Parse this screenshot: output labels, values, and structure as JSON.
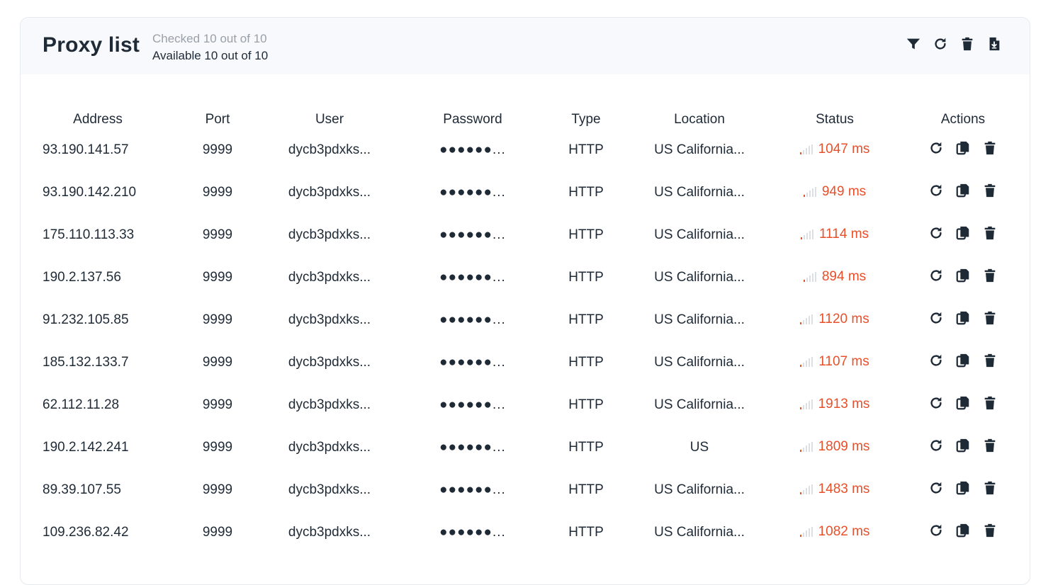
{
  "header": {
    "title": "Proxy list",
    "checked": "Checked 10 out of 10",
    "available": "Available 10 out of 10"
  },
  "toolbar": {
    "icons": [
      "filter-icon",
      "refresh-icon",
      "trash-icon",
      "file-download-icon"
    ]
  },
  "colors": {
    "accent": "#e8502a",
    "text": "#1f2a37",
    "muted": "#9aa0a8",
    "header_bg": "#f7f9fc"
  },
  "table": {
    "columns": [
      "Address",
      "Port",
      "User",
      "Password",
      "Type",
      "Location",
      "Status",
      "Actions"
    ],
    "rows": [
      {
        "address": "93.190.141.57",
        "port": "9999",
        "user": "dycb3pdxks...",
        "password": "●●●●●●...",
        "type": "HTTP",
        "location": "US California...",
        "status": "1047 ms"
      },
      {
        "address": "93.190.142.210",
        "port": "9999",
        "user": "dycb3pdxks...",
        "password": "●●●●●●...",
        "type": "HTTP",
        "location": "US California...",
        "status": "949 ms"
      },
      {
        "address": "175.110.113.33",
        "port": "9999",
        "user": "dycb3pdxks...",
        "password": "●●●●●●...",
        "type": "HTTP",
        "location": "US California...",
        "status": "1114 ms"
      },
      {
        "address": "190.2.137.56",
        "port": "9999",
        "user": "dycb3pdxks...",
        "password": "●●●●●●...",
        "type": "HTTP",
        "location": "US California...",
        "status": "894 ms"
      },
      {
        "address": "91.232.105.85",
        "port": "9999",
        "user": "dycb3pdxks...",
        "password": "●●●●●●...",
        "type": "HTTP",
        "location": "US California...",
        "status": "1120 ms"
      },
      {
        "address": "185.132.133.7",
        "port": "9999",
        "user": "dycb3pdxks...",
        "password": "●●●●●●...",
        "type": "HTTP",
        "location": "US California...",
        "status": "1107 ms"
      },
      {
        "address": "62.112.11.28",
        "port": "9999",
        "user": "dycb3pdxks...",
        "password": "●●●●●●...",
        "type": "HTTP",
        "location": "US California...",
        "status": "1913 ms"
      },
      {
        "address": "190.2.142.241",
        "port": "9999",
        "user": "dycb3pdxks...",
        "password": "●●●●●●...",
        "type": "HTTP",
        "location": "US",
        "status": "1809 ms"
      },
      {
        "address": "89.39.107.55",
        "port": "9999",
        "user": "dycb3pdxks...",
        "password": "●●●●●●...",
        "type": "HTTP",
        "location": "US California...",
        "status": "1483 ms"
      },
      {
        "address": "109.236.82.42",
        "port": "9999",
        "user": "dycb3pdxks...",
        "password": "●●●●●●...",
        "type": "HTTP",
        "location": "US California...",
        "status": "1082 ms"
      }
    ],
    "row_actions": [
      "refresh-icon",
      "copy-icon",
      "trash-icon"
    ]
  }
}
